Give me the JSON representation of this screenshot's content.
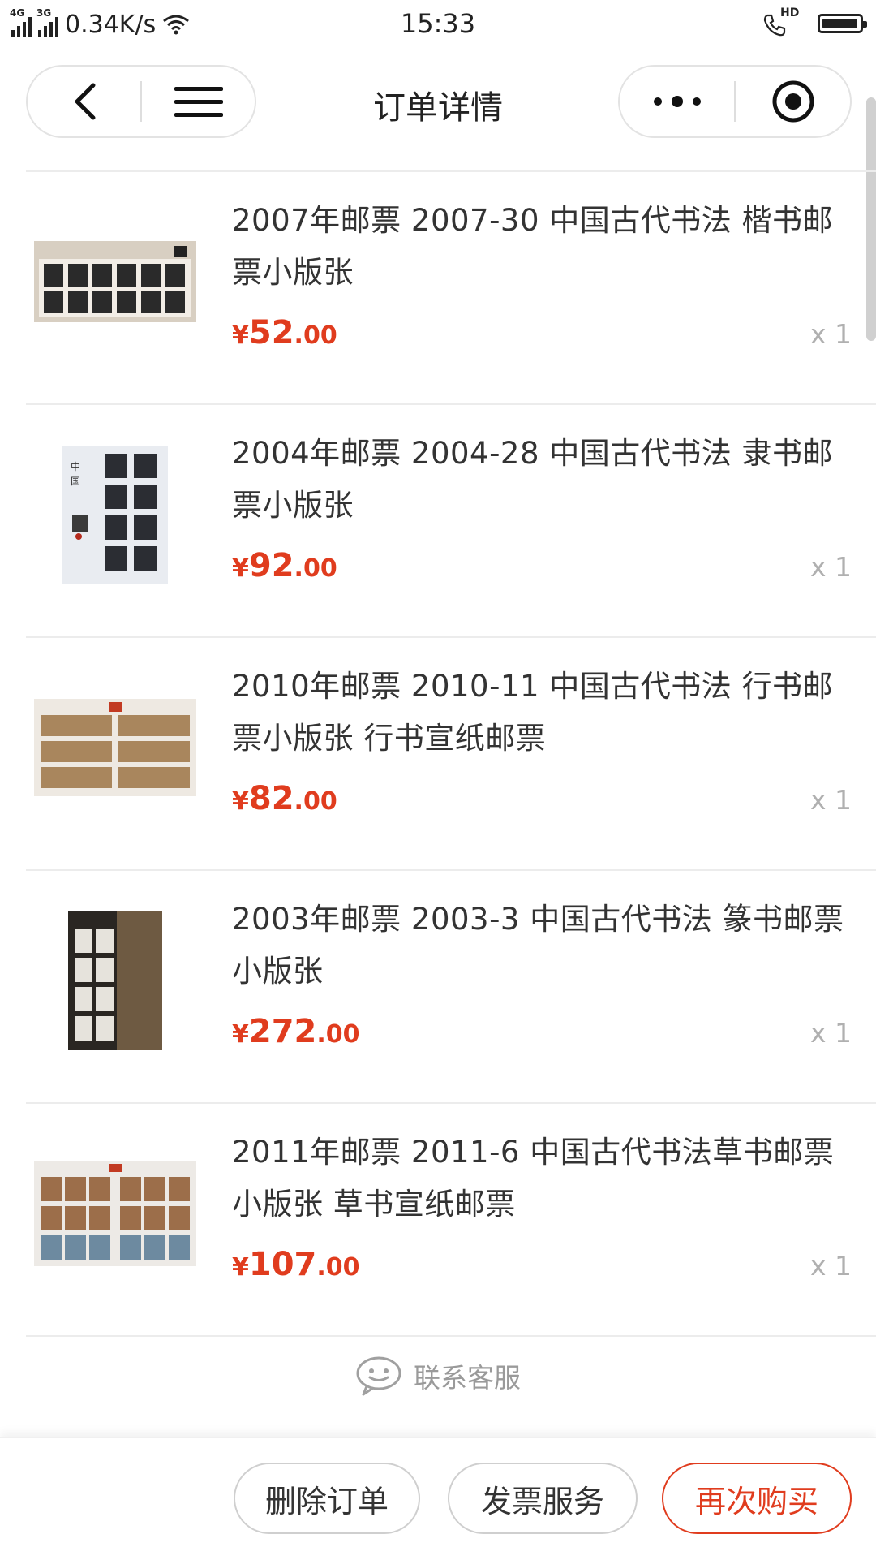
{
  "status_bar": {
    "net1": "4G",
    "net2": "3G",
    "speed": "0.34K/s",
    "time": "15:33",
    "hd": "HD",
    "battery_level": 0.85
  },
  "header": {
    "title": "订单详情"
  },
  "colors": {
    "price": "#e03c1e",
    "accent": "#e03c1e"
  },
  "items": [
    {
      "name": "2007年邮票 2007-30 中国古代书法 楷书邮票小版张",
      "currency": "¥",
      "price_int": "52",
      "price_dec": ".00",
      "qty": "x 1"
    },
    {
      "name": "2004年邮票 2004-28 中国古代书法 隶书邮票小版张",
      "currency": "¥",
      "price_int": "92",
      "price_dec": ".00",
      "qty": "x 1"
    },
    {
      "name": "2010年邮票 2010-11 中国古代书法 行书邮票小版张 行书宣纸邮票",
      "currency": "¥",
      "price_int": "82",
      "price_dec": ".00",
      "qty": "x 1"
    },
    {
      "name": "2003年邮票 2003-3 中国古代书法 篆书邮票小版张",
      "currency": "¥",
      "price_int": "272",
      "price_dec": ".00",
      "qty": "x 1"
    },
    {
      "name": "2011年邮票 2011-6 中国古代书法草书邮票小版张 草书宣纸邮票",
      "currency": "¥",
      "price_int": "107",
      "price_dec": ".00",
      "qty": "x 1"
    }
  ],
  "service": {
    "label": "联系客服"
  },
  "actions": {
    "delete": "删除订单",
    "invoice": "发票服务",
    "rebuy": "再次购买"
  }
}
